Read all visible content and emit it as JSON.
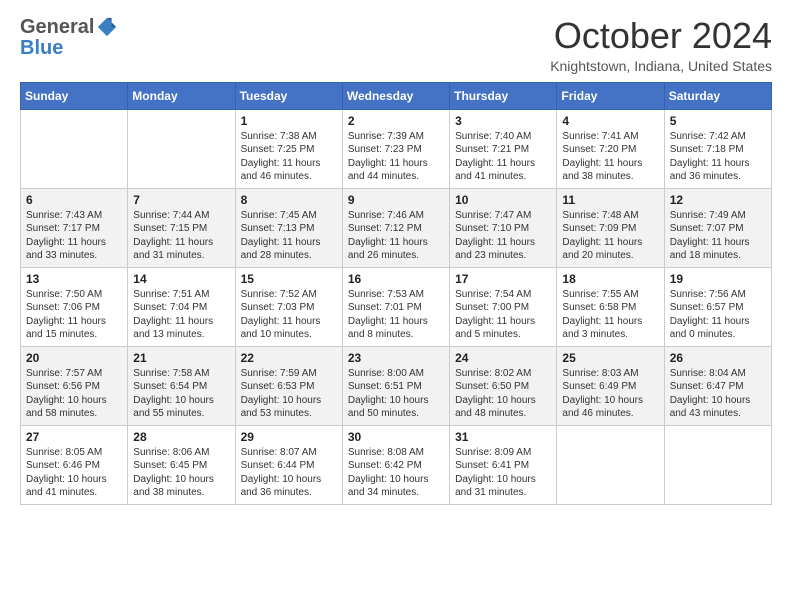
{
  "logo": {
    "general": "General",
    "blue": "Blue"
  },
  "header": {
    "title": "October 2024",
    "location": "Knightstown, Indiana, United States"
  },
  "days_of_week": [
    "Sunday",
    "Monday",
    "Tuesday",
    "Wednesday",
    "Thursday",
    "Friday",
    "Saturday"
  ],
  "weeks": [
    [
      null,
      null,
      {
        "day": "1",
        "sunrise": "Sunrise: 7:38 AM",
        "sunset": "Sunset: 7:25 PM",
        "daylight": "Daylight: 11 hours and 46 minutes."
      },
      {
        "day": "2",
        "sunrise": "Sunrise: 7:39 AM",
        "sunset": "Sunset: 7:23 PM",
        "daylight": "Daylight: 11 hours and 44 minutes."
      },
      {
        "day": "3",
        "sunrise": "Sunrise: 7:40 AM",
        "sunset": "Sunset: 7:21 PM",
        "daylight": "Daylight: 11 hours and 41 minutes."
      },
      {
        "day": "4",
        "sunrise": "Sunrise: 7:41 AM",
        "sunset": "Sunset: 7:20 PM",
        "daylight": "Daylight: 11 hours and 38 minutes."
      },
      {
        "day": "5",
        "sunrise": "Sunrise: 7:42 AM",
        "sunset": "Sunset: 7:18 PM",
        "daylight": "Daylight: 11 hours and 36 minutes."
      }
    ],
    [
      {
        "day": "6",
        "sunrise": "Sunrise: 7:43 AM",
        "sunset": "Sunset: 7:17 PM",
        "daylight": "Daylight: 11 hours and 33 minutes."
      },
      {
        "day": "7",
        "sunrise": "Sunrise: 7:44 AM",
        "sunset": "Sunset: 7:15 PM",
        "daylight": "Daylight: 11 hours and 31 minutes."
      },
      {
        "day": "8",
        "sunrise": "Sunrise: 7:45 AM",
        "sunset": "Sunset: 7:13 PM",
        "daylight": "Daylight: 11 hours and 28 minutes."
      },
      {
        "day": "9",
        "sunrise": "Sunrise: 7:46 AM",
        "sunset": "Sunset: 7:12 PM",
        "daylight": "Daylight: 11 hours and 26 minutes."
      },
      {
        "day": "10",
        "sunrise": "Sunrise: 7:47 AM",
        "sunset": "Sunset: 7:10 PM",
        "daylight": "Daylight: 11 hours and 23 minutes."
      },
      {
        "day": "11",
        "sunrise": "Sunrise: 7:48 AM",
        "sunset": "Sunset: 7:09 PM",
        "daylight": "Daylight: 11 hours and 20 minutes."
      },
      {
        "day": "12",
        "sunrise": "Sunrise: 7:49 AM",
        "sunset": "Sunset: 7:07 PM",
        "daylight": "Daylight: 11 hours and 18 minutes."
      }
    ],
    [
      {
        "day": "13",
        "sunrise": "Sunrise: 7:50 AM",
        "sunset": "Sunset: 7:06 PM",
        "daylight": "Daylight: 11 hours and 15 minutes."
      },
      {
        "day": "14",
        "sunrise": "Sunrise: 7:51 AM",
        "sunset": "Sunset: 7:04 PM",
        "daylight": "Daylight: 11 hours and 13 minutes."
      },
      {
        "day": "15",
        "sunrise": "Sunrise: 7:52 AM",
        "sunset": "Sunset: 7:03 PM",
        "daylight": "Daylight: 11 hours and 10 minutes."
      },
      {
        "day": "16",
        "sunrise": "Sunrise: 7:53 AM",
        "sunset": "Sunset: 7:01 PM",
        "daylight": "Daylight: 11 hours and 8 minutes."
      },
      {
        "day": "17",
        "sunrise": "Sunrise: 7:54 AM",
        "sunset": "Sunset: 7:00 PM",
        "daylight": "Daylight: 11 hours and 5 minutes."
      },
      {
        "day": "18",
        "sunrise": "Sunrise: 7:55 AM",
        "sunset": "Sunset: 6:58 PM",
        "daylight": "Daylight: 11 hours and 3 minutes."
      },
      {
        "day": "19",
        "sunrise": "Sunrise: 7:56 AM",
        "sunset": "Sunset: 6:57 PM",
        "daylight": "Daylight: 11 hours and 0 minutes."
      }
    ],
    [
      {
        "day": "20",
        "sunrise": "Sunrise: 7:57 AM",
        "sunset": "Sunset: 6:56 PM",
        "daylight": "Daylight: 10 hours and 58 minutes."
      },
      {
        "day": "21",
        "sunrise": "Sunrise: 7:58 AM",
        "sunset": "Sunset: 6:54 PM",
        "daylight": "Daylight: 10 hours and 55 minutes."
      },
      {
        "day": "22",
        "sunrise": "Sunrise: 7:59 AM",
        "sunset": "Sunset: 6:53 PM",
        "daylight": "Daylight: 10 hours and 53 minutes."
      },
      {
        "day": "23",
        "sunrise": "Sunrise: 8:00 AM",
        "sunset": "Sunset: 6:51 PM",
        "daylight": "Daylight: 10 hours and 50 minutes."
      },
      {
        "day": "24",
        "sunrise": "Sunrise: 8:02 AM",
        "sunset": "Sunset: 6:50 PM",
        "daylight": "Daylight: 10 hours and 48 minutes."
      },
      {
        "day": "25",
        "sunrise": "Sunrise: 8:03 AM",
        "sunset": "Sunset: 6:49 PM",
        "daylight": "Daylight: 10 hours and 46 minutes."
      },
      {
        "day": "26",
        "sunrise": "Sunrise: 8:04 AM",
        "sunset": "Sunset: 6:47 PM",
        "daylight": "Daylight: 10 hours and 43 minutes."
      }
    ],
    [
      {
        "day": "27",
        "sunrise": "Sunrise: 8:05 AM",
        "sunset": "Sunset: 6:46 PM",
        "daylight": "Daylight: 10 hours and 41 minutes."
      },
      {
        "day": "28",
        "sunrise": "Sunrise: 8:06 AM",
        "sunset": "Sunset: 6:45 PM",
        "daylight": "Daylight: 10 hours and 38 minutes."
      },
      {
        "day": "29",
        "sunrise": "Sunrise: 8:07 AM",
        "sunset": "Sunset: 6:44 PM",
        "daylight": "Daylight: 10 hours and 36 minutes."
      },
      {
        "day": "30",
        "sunrise": "Sunrise: 8:08 AM",
        "sunset": "Sunset: 6:42 PM",
        "daylight": "Daylight: 10 hours and 34 minutes."
      },
      {
        "day": "31",
        "sunrise": "Sunrise: 8:09 AM",
        "sunset": "Sunset: 6:41 PM",
        "daylight": "Daylight: 10 hours and 31 minutes."
      },
      null,
      null
    ]
  ]
}
